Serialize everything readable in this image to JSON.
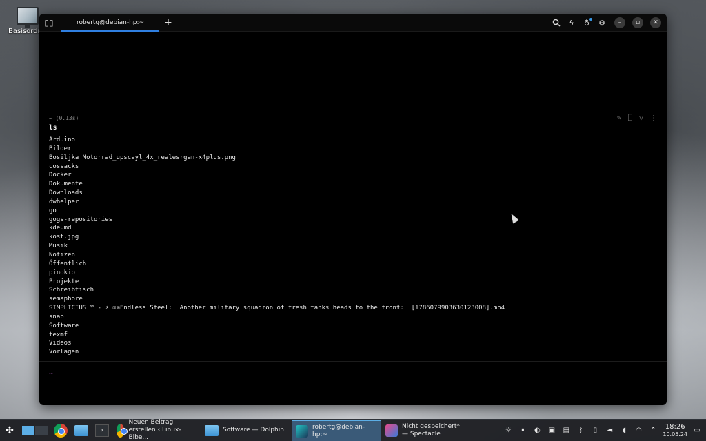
{
  "desktop": {
    "icon_label": "Basisordner"
  },
  "window": {
    "tab_title": "robertg@debian-hp:~",
    "icons": {
      "split": "book-icon",
      "search": "search-icon",
      "bolt": "bolt-icon",
      "bulb": "lightbulb-icon",
      "settings": "gear-icon"
    }
  },
  "block": {
    "meta": "~ (0.13s)",
    "command": "ls",
    "output": [
      "Arduino",
      "Bilder",
      "Bosiljka Motorrad_upscayl_4x_realesrgan-x4plus.png",
      "cossacks",
      "Docker",
      "Dokumente",
      "Downloads",
      "dwhelper",
      "go",
      "gogs-repositories",
      "kde.md",
      "kost.jpg",
      "Musik",
      "Notizen",
      "Öffentlich",
      "pinokio",
      "Projekte",
      "Schreibtisch",
      "semaphore",
      "SIMPLICIUS ♈ - ⚡ ☒☒Endless Steel:  Another military squadron of fresh tanks heads to the front:  [1786079903630123008].mp4",
      "snap",
      "Software",
      "texmf",
      "Videos",
      "Vorlagen"
    ]
  },
  "prompt": {
    "symbol": "~"
  },
  "taskbar": {
    "tasks": [
      {
        "label": "Neuen Beitrag erstellen ‹ Linux-Bibe...",
        "icon": "chrome-icon"
      },
      {
        "label": "Software — Dolphin",
        "icon": "folder-icon"
      },
      {
        "label": "robertg@debian-hp:~",
        "icon": "warp-icon"
      },
      {
        "label": "Nicht gespeichert* — Spectacle",
        "icon": "spectacle-icon"
      }
    ],
    "clock": {
      "time": "18:26",
      "date": "10.05.24"
    }
  }
}
